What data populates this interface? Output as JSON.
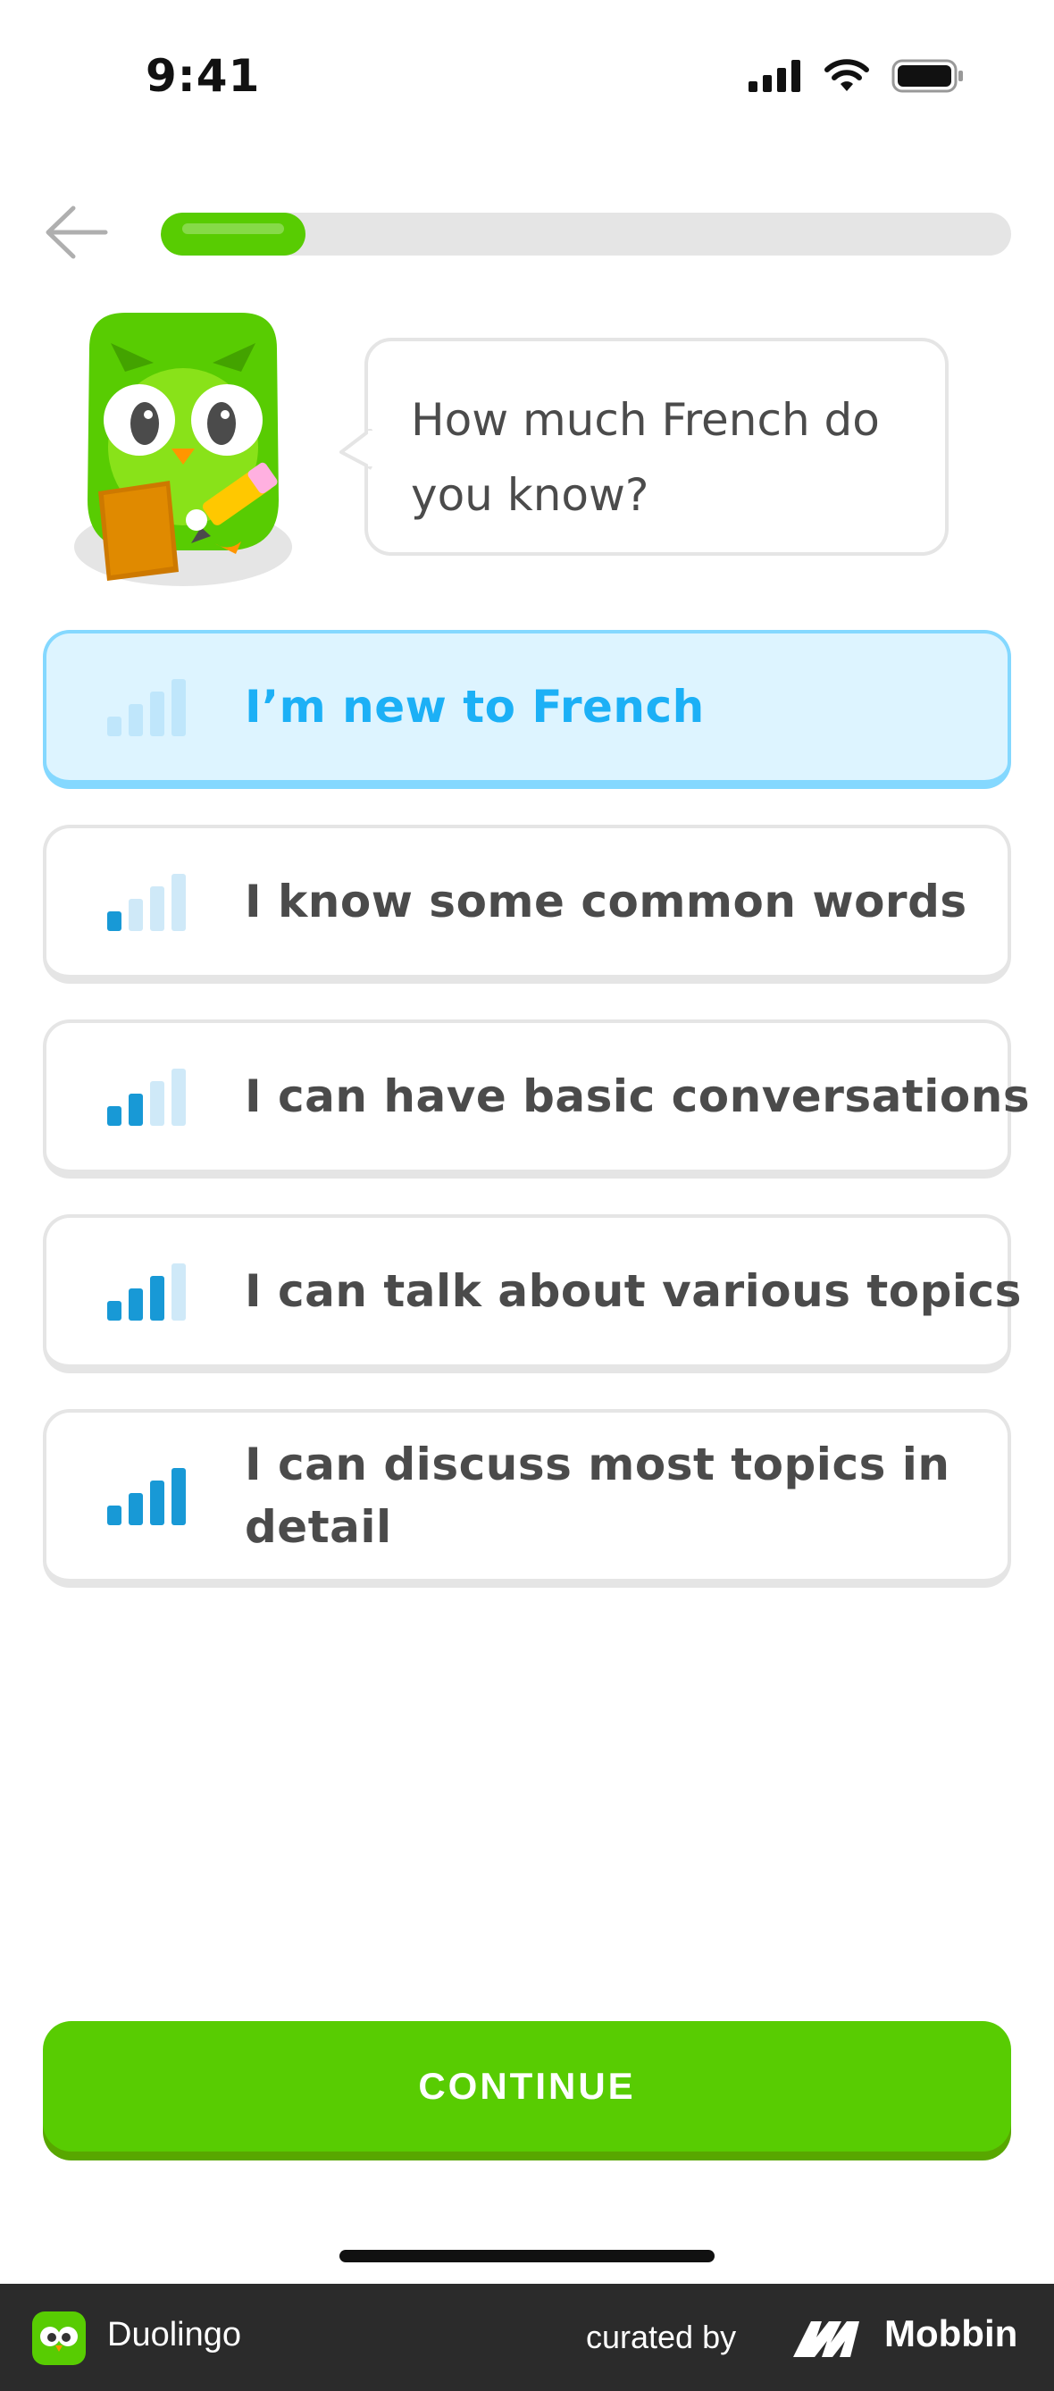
{
  "status_bar": {
    "time": "9:41"
  },
  "header": {
    "progress_fraction": 0.17
  },
  "prompt": {
    "question": "How much French do you know?"
  },
  "options": [
    {
      "label": "I’m new to French",
      "level": 0,
      "selected": true
    },
    {
      "label": "I know some common words",
      "level": 1,
      "selected": false
    },
    {
      "label": "I can have basic conversations",
      "level": 2,
      "selected": false
    },
    {
      "label": "I can talk about various topics",
      "level": 3,
      "selected": false
    },
    {
      "label": "I can discuss most topics in detail",
      "level": 4,
      "selected": false
    }
  ],
  "actions": {
    "continue_label": "CONTINUE"
  },
  "footer": {
    "app_name": "Duolingo",
    "curated_by": "curated by",
    "brand": "Mobbin"
  },
  "colors": {
    "brand_green": "#58cc02",
    "selected_blue": "#1cb0f6",
    "selected_bg": "#ddf4ff",
    "selected_border": "#84d8ff",
    "bar_active": "#1899d6",
    "bar_inactive": "#cfe9f8"
  },
  "icons": {
    "back": "arrow-left-icon",
    "signal": "cellular-signal-icon",
    "wifi": "wifi-icon",
    "battery": "battery-icon",
    "level_bars": "signal-bars-icon"
  }
}
